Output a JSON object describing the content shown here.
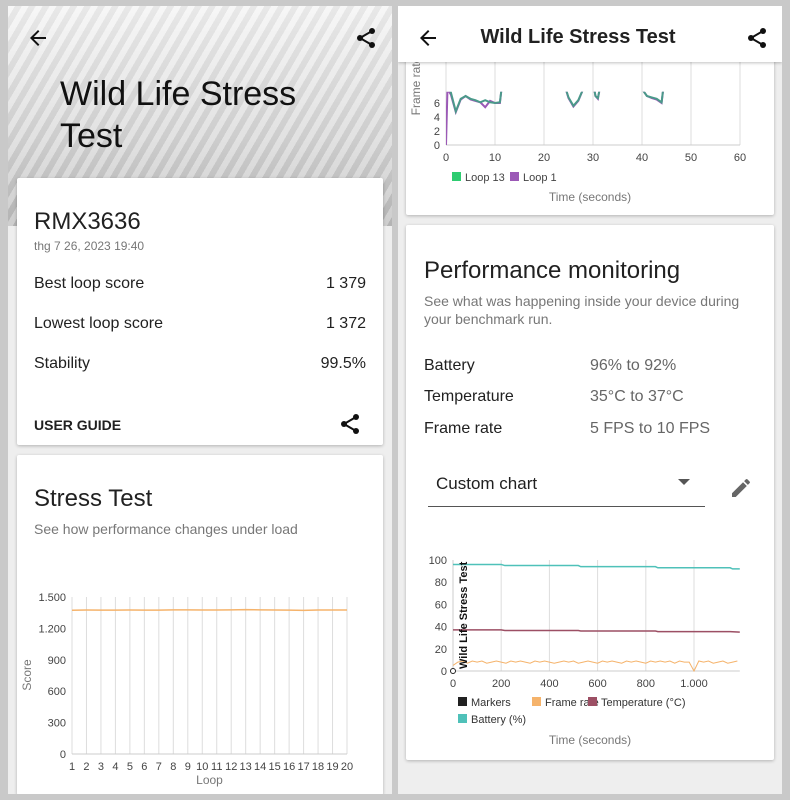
{
  "left": {
    "title": "Wild Life Stress Test",
    "device": "RMX3636",
    "date": "thg 7 26, 2023 19:40",
    "stats": [
      {
        "label": "Best loop score",
        "value": "1 379"
      },
      {
        "label": "Lowest loop score",
        "value": "1 372"
      },
      {
        "label": "Stability",
        "value": "99.5%"
      }
    ],
    "user_guide": "USER GUIDE",
    "stress": {
      "title": "Stress Test",
      "subtitle": "See how performance changes under load"
    }
  },
  "right": {
    "header_title": "Wild Life Stress Test",
    "perf": {
      "title": "Performance monitoring",
      "subtitle_1": "See what was happening inside your device during",
      "subtitle_2": "your benchmark run.",
      "rows": [
        {
          "label": "Battery",
          "value": "96% to 92%"
        },
        {
          "label": "Temperature",
          "value": "35°C to 37°C"
        },
        {
          "label": "Frame rate",
          "value": "5 FPS to 10 FPS"
        }
      ],
      "dropdown": "Custom chart"
    }
  },
  "icons": {
    "back": "arrow-left-icon",
    "share": "share-icon",
    "dropdown": "caret-down-icon",
    "edit": "pencil-icon"
  },
  "colors": {
    "score": "#f5b36b",
    "loop13": "#2ecc71",
    "loop1": "#9b59b6",
    "loopline": "#4a9a8a",
    "framerate": "#f5b36b",
    "temperature": "#9c4f64",
    "battery": "#4fc1b9",
    "markers": "#212121"
  },
  "chart_data": [
    {
      "type": "line",
      "ylabel": "Score",
      "xlabel": "Loop",
      "ylim": [
        0,
        1500
      ],
      "yticks": [
        "0",
        "300",
        "600",
        "900",
        "1.200",
        "1.500"
      ],
      "categories": [
        "1",
        "2",
        "3",
        "4",
        "5",
        "6",
        "7",
        "8",
        "9",
        "10",
        "11",
        "12",
        "13",
        "14",
        "15",
        "16",
        "17",
        "18",
        "19",
        "20"
      ],
      "values": [
        1374,
        1376,
        1375,
        1375,
        1376,
        1375,
        1375,
        1377,
        1377,
        1376,
        1376,
        1377,
        1379,
        1377,
        1376,
        1375,
        1372,
        1376,
        1376,
        1376
      ],
      "grid": true
    },
    {
      "type": "line",
      "ylabel": "Frame rate",
      "xlabel": "Time (seconds)",
      "xlim": [
        0,
        60
      ],
      "xticks": [
        "0",
        "10",
        "20",
        "30",
        "40",
        "50",
        "60"
      ],
      "yticks": [
        "0",
        "2",
        "4",
        "6"
      ],
      "legend": "bottom-left",
      "series": [
        {
          "name": "Loop 13",
          "points": [
            [
              0.4,
              9
            ],
            [
              1,
              7.5
            ],
            [
              2,
              4.8
            ],
            [
              3,
              6.6
            ],
            [
              4,
              7
            ],
            [
              5,
              6.6
            ],
            [
              6,
              6.4
            ],
            [
              7,
              6.1
            ],
            [
              8,
              6.4
            ],
            [
              9,
              6.1
            ],
            [
              10,
              6
            ],
            [
              11,
              6.1
            ],
            [
              11.5,
              9
            ],
            [
              24,
              9
            ],
            [
              25,
              6.8
            ],
            [
              26,
              5.6
            ],
            [
              27,
              6.4
            ],
            [
              28,
              8
            ],
            [
              30,
              9
            ],
            [
              30.5,
              7
            ],
            [
              31,
              6.7
            ],
            [
              31.5,
              8.5
            ],
            [
              40,
              8
            ],
            [
              41,
              7
            ],
            [
              42,
              6.8
            ],
            [
              43,
              6.6
            ],
            [
              44,
              6.1
            ],
            [
              44.5,
              9
            ]
          ]
        },
        {
          "name": "Loop 1",
          "points": [
            [
              0,
              0
            ],
            [
              0.3,
              8
            ],
            [
              1,
              7.2
            ],
            [
              2,
              4.7
            ],
            [
              3,
              6.5
            ],
            [
              4,
              7
            ],
            [
              5,
              6.5
            ],
            [
              6,
              6.3
            ],
            [
              7,
              6.1
            ],
            [
              8,
              5.4
            ],
            [
              9,
              6.3
            ],
            [
              10,
              6
            ],
            [
              11,
              6
            ],
            [
              11.5,
              9
            ],
            [
              24,
              9
            ],
            [
              25,
              6.7
            ],
            [
              26,
              5.5
            ],
            [
              27,
              6.3
            ],
            [
              28,
              8
            ],
            [
              30,
              9
            ],
            [
              30.5,
              7
            ],
            [
              31,
              6.6
            ],
            [
              31.5,
              8.5
            ],
            [
              40,
              8
            ],
            [
              41,
              7
            ],
            [
              42,
              6.7
            ],
            [
              43,
              6.5
            ],
            [
              44,
              6
            ],
            [
              44.5,
              9
            ]
          ]
        }
      ]
    },
    {
      "type": "line",
      "xlabel": "Time (seconds)",
      "xlim": [
        0,
        1190
      ],
      "ylim": [
        0,
        100
      ],
      "xticks": [
        "0",
        "200",
        "400",
        "600",
        "800",
        "1.000"
      ],
      "yticks": [
        "0",
        "20",
        "40",
        "60",
        "80",
        "100"
      ],
      "annotation": "Wild Life Stress Test",
      "legend": "bottom",
      "series": [
        {
          "name": "Markers",
          "points": [
            [
              0,
              0
            ]
          ]
        },
        {
          "name": "Frame rate",
          "values_every_20s": [
            5,
            8,
            9,
            7,
            9,
            8,
            9,
            7,
            8,
            9,
            8,
            7,
            9,
            8,
            9,
            8,
            7,
            9,
            8,
            9,
            8,
            7,
            8,
            9,
            8,
            9,
            7,
            8,
            9,
            8,
            7,
            9,
            8,
            9,
            8,
            7,
            9,
            8,
            9,
            8,
            7,
            9,
            8,
            9,
            8,
            9,
            7,
            9,
            8,
            8,
            0,
            9,
            8,
            9,
            7,
            8,
            9,
            7,
            8,
            9
          ]
        },
        {
          "name": "Temperature (°C)",
          "points": [
            [
              0,
              37
            ],
            [
              200,
              37
            ],
            [
              215,
              36.5
            ],
            [
              520,
              36.5
            ],
            [
              530,
              36
            ],
            [
              840,
              36
            ],
            [
              850,
              35.5
            ],
            [
              1150,
              35.5
            ],
            [
              1190,
              35
            ]
          ]
        },
        {
          "name": "Battery (%)",
          "points": [
            [
              0,
              96
            ],
            [
              200,
              96
            ],
            [
              215,
              95
            ],
            [
              520,
              95
            ],
            [
              530,
              94
            ],
            [
              840,
              94
            ],
            [
              850,
              93
            ],
            [
              1150,
              93
            ],
            [
              1160,
              92
            ],
            [
              1190,
              92
            ]
          ]
        }
      ]
    }
  ]
}
